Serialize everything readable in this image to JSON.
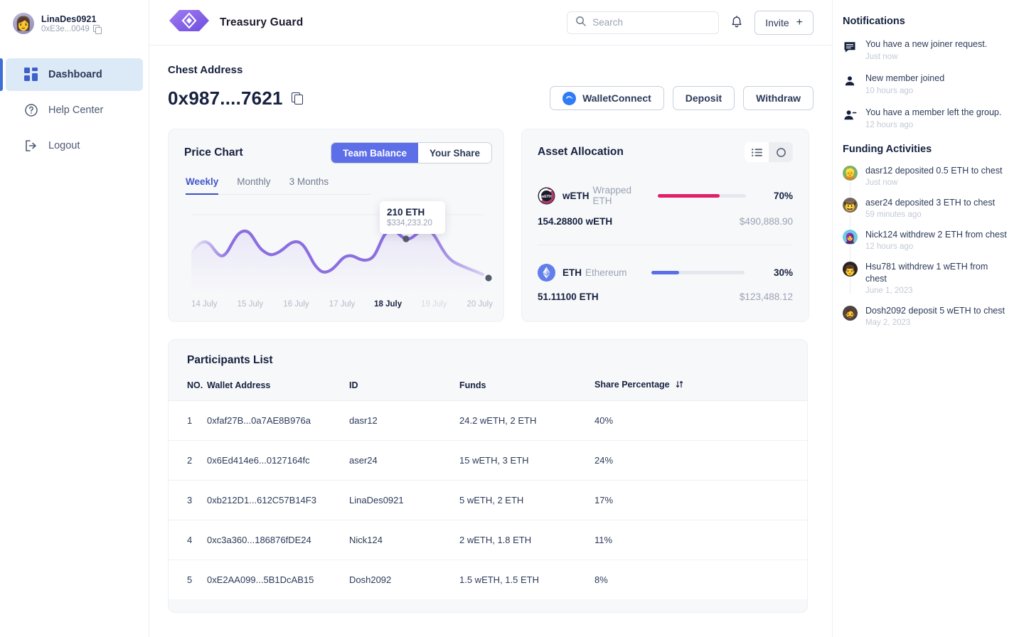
{
  "sidebar": {
    "profile": {
      "name": "LinaDes0921",
      "address": "0xE3e...0049",
      "copy_icon": "copy-icon",
      "avatar_glyph": "👩"
    },
    "items": [
      {
        "label": "Dashboard",
        "icon": "dashboard-grid-icon",
        "active": true
      },
      {
        "label": "Help Center",
        "icon": "question-circle-icon",
        "active": false
      },
      {
        "label": "Logout",
        "icon": "logout-arrow-icon",
        "active": false
      }
    ]
  },
  "header": {
    "brand": "Treasury Guard",
    "logo_icon": "hexagon-diamond-logo",
    "search": {
      "placeholder": "Search",
      "value": "",
      "icon": "search-icon"
    },
    "bell_icon": "bell-icon",
    "invite_label": "Invite",
    "invite_plus": "+"
  },
  "main": {
    "chest_label": "Chest Address",
    "chest_address": "0x987....7621",
    "copy_icon": "copy-icon",
    "actions": [
      {
        "label": "WalletConnect",
        "icon": "walletconnect-icon"
      },
      {
        "label": "Deposit",
        "icon": ""
      },
      {
        "label": "Withdraw",
        "icon": ""
      }
    ],
    "price_chart": {
      "title": "Price Chart",
      "segments": [
        {
          "label": "Team Balance",
          "selected": true
        },
        {
          "label": "Your Share",
          "selected": false
        }
      ],
      "tabs": [
        {
          "label": "Weekly",
          "selected": true
        },
        {
          "label": "Monthly",
          "selected": false
        },
        {
          "label": "3 Months",
          "selected": false
        }
      ],
      "tooltip": {
        "value": "210 ETH",
        "usd": "$334,233.20"
      }
    },
    "allocation": {
      "title": "Asset Allocation",
      "view_list_icon": "list-view-icon",
      "view_donut_icon": "donut-chart-icon",
      "rows": [
        {
          "symbol": "wETH",
          "name": "Wrapped ETH",
          "percent": "70%",
          "percent_value": 70,
          "amount": "154.28800 wETH",
          "usd": "$490,888.90",
          "color": "#e0206a",
          "icon": "weth-token-icon"
        },
        {
          "symbol": "ETH",
          "name": "Ethereum",
          "percent": "30%",
          "percent_value": 30,
          "amount": "51.11100 ETH",
          "usd": "$123,488.12",
          "color": "#5c6ee8",
          "icon": "eth-token-icon"
        }
      ]
    },
    "participants": {
      "title": "Participants List",
      "columns": [
        "NO.",
        "Wallet Address",
        "ID",
        "Funds",
        "Share Percentage"
      ],
      "sort_icon": "sort-updown-icon",
      "rows": [
        {
          "no": "1",
          "wallet": "0xfaf27B...0a7AE8B976a",
          "id": "dasr12",
          "funds": "24.2 wETH, 2 ETH",
          "share": "40%"
        },
        {
          "no": "2",
          "wallet": "0x6Ed414e6...0127164fc",
          "id": "aser24",
          "funds": "15 wETH, 3 ETH",
          "share": "24%"
        },
        {
          "no": "3",
          "wallet": "0xb212D1...612C57B14F3",
          "id": "LinaDes0921",
          "funds": "5 wETH, 2 ETH",
          "share": "17%"
        },
        {
          "no": "4",
          "wallet": "0xc3a360...186876fDE24",
          "id": "Nick124",
          "funds": "2 wETH, 1.8 ETH",
          "share": "11%"
        },
        {
          "no": "5",
          "wallet": "0xE2AA099...5B1DcAB15",
          "id": "Dosh2092",
          "funds": "1.5 wETH, 1.5 ETH",
          "share": "8%"
        }
      ]
    }
  },
  "right": {
    "notifications_title": "Notifications",
    "notifications": [
      {
        "text": "You have a new joiner request.",
        "time": "Just now",
        "icon": "message-square-icon"
      },
      {
        "text": "New member joined",
        "time": "10 hours ago",
        "icon": "user-icon"
      },
      {
        "text": "You have a member left the group.",
        "time": "12 hours ago",
        "icon": "user-minus-icon"
      }
    ],
    "funding_title": "Funding Activities",
    "funding": [
      {
        "text": "dasr12 deposited 0.5 ETH to chest",
        "time": "Just now",
        "avatar": "#7fae6b",
        "glyph": "👱"
      },
      {
        "text": "aser24 deposited 3 ETH to chest",
        "time": "59 minutes ago",
        "avatar": "#3d3a33",
        "glyph": "🤠"
      },
      {
        "text": "Nick124 withdrew 2 ETH from chest",
        "time": "12 hours ago",
        "avatar": "#6fcbe3",
        "glyph": "🧕"
      },
      {
        "text": "Hsu781 withdrew 1 wETH from chest",
        "time": "June 1, 2023",
        "avatar": "#2b2420",
        "glyph": "👨"
      },
      {
        "text": "Dosh2092 deposit 5 wETH to chest",
        "time": "May 2, 2023",
        "avatar": "#4a4440",
        "glyph": "🧔"
      }
    ]
  },
  "chart_data": {
    "type": "line",
    "title": "Price Chart",
    "xlabel": "",
    "ylabel": "ETH",
    "categories": [
      "14 July",
      "15 July",
      "16 July",
      "17 July",
      "18 July",
      "19 July",
      "20 July"
    ],
    "tick_states": [
      "normal",
      "normal",
      "normal",
      "normal",
      "highlight",
      "dim",
      "normal"
    ],
    "series": [
      {
        "name": "Team Balance",
        "color": "#8b6fe0",
        "values": [
          172,
          186,
          160,
          178,
          150,
          166,
          210,
          196,
          176,
          158
        ]
      }
    ],
    "highlight_point": {
      "label": "18 July",
      "value": "210 ETH",
      "usd": "$334,233.20"
    },
    "grid": false,
    "legend": false
  }
}
